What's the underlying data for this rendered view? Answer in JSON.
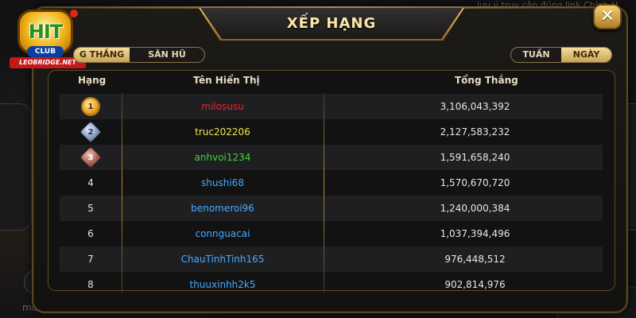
{
  "background": {
    "top_strip_text": "lưu ý truy cập đúng link Chính H",
    "bottom_left_text": "mocham13"
  },
  "logo": {
    "brand": "HIT",
    "sub": "CLUB",
    "tagline": "LEOBRIDGE.NET"
  },
  "modal": {
    "title": "XẾP HẠNG",
    "close_icon": "close-icon"
  },
  "tabs_left": {
    "items": [
      {
        "label": "G THẮNG",
        "active": true
      },
      {
        "label": "SĂN HŨ",
        "active": false
      }
    ]
  },
  "tabs_right": {
    "items": [
      {
        "label": "TUẦN",
        "active": false
      },
      {
        "label": "NGÀY",
        "active": true
      }
    ]
  },
  "table": {
    "headers": {
      "rank": "Hạng",
      "name": "Tên Hiển Thị",
      "total": "Tổng Thắng"
    },
    "rows": [
      {
        "rank": "1",
        "name": "milosusu",
        "total": "3,106,043,392",
        "name_color": "#e8262a",
        "medal": "gold"
      },
      {
        "rank": "2",
        "name": "truc202206",
        "total": "2,127,583,232",
        "name_color": "#f2e64a",
        "medal": "silver"
      },
      {
        "rank": "3",
        "name": "anhvoi1234",
        "total": "1,591,658,240",
        "name_color": "#3fd43a",
        "medal": "bronze"
      },
      {
        "rank": "4",
        "name": "shushi68",
        "total": "1,570,670,720",
        "name_color": "#47a9ff"
      },
      {
        "rank": "5",
        "name": "benomeroi96",
        "total": "1,240,000,384",
        "name_color": "#47a9ff"
      },
      {
        "rank": "6",
        "name": "connguacai",
        "total": "1,037,394,496",
        "name_color": "#47a9ff"
      },
      {
        "rank": "7",
        "name": "ChauTinhTinh165",
        "total": "976,448,512",
        "name_color": "#47a9ff"
      },
      {
        "rank": "8",
        "name": "thuuxinhh2k5",
        "total": "902,814,976",
        "name_color": "#47a9ff"
      }
    ]
  },
  "colors": {
    "gold_accent": "#c79a3d",
    "title_text": "#fbe7a7"
  }
}
